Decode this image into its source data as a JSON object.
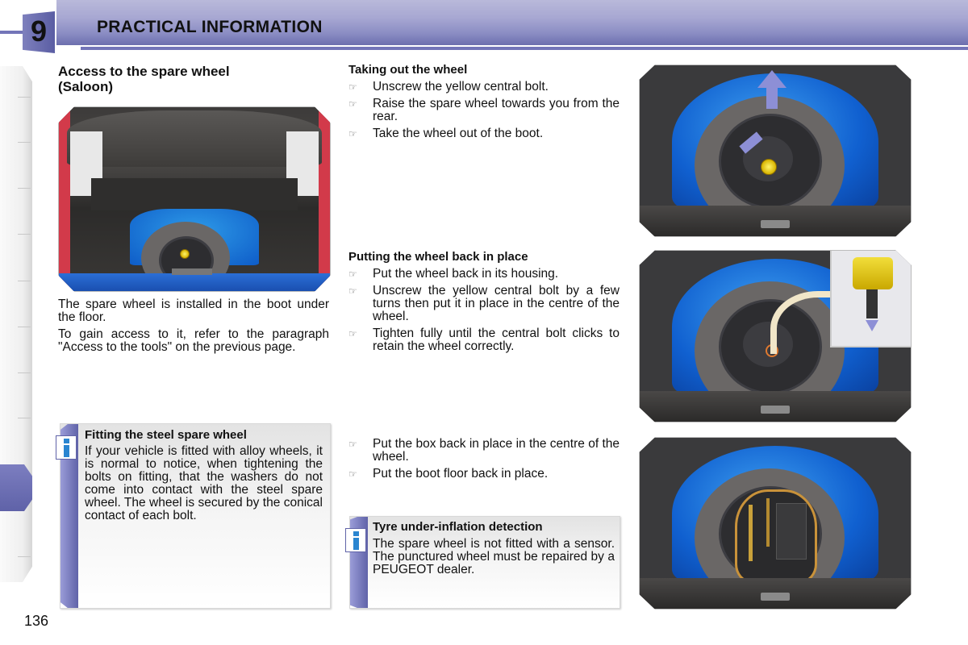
{
  "header": {
    "chapter_number": "9",
    "title": "PRACTICAL INFORMATION"
  },
  "left_column": {
    "heading_line1": "Access to the spare wheel",
    "heading_line2": "(Saloon)",
    "paragraphs": [
      "The spare wheel is installed in the boot under the floor.",
      "To gain access to it, refer to the paragraph \"Access to the tools\" on the previous page."
    ],
    "info_box": {
      "title": "Fitting the steel spare wheel",
      "text": "If your vehicle is fitted with alloy wheels, it is normal to notice, when tightening the bolts on fitting, that the washers do not come into contact with the steel spare wheel. The wheel is secured by the conical contact of each bolt."
    }
  },
  "middle_column": {
    "taking_out": {
      "title": "Taking out the wheel",
      "steps": [
        "Unscrew the yellow central bolt.",
        "Raise the spare wheel towards you from the rear.",
        "Take the wheel out of the boot."
      ]
    },
    "putting_back": {
      "title": "Putting the wheel back in place",
      "steps": [
        "Put the wheel back in its housing.",
        "Unscrew the yellow central bolt by a few turns then put it in place in the centre of the wheel.",
        "Tighten fully until the central bolt clicks to retain the wheel correctly."
      ]
    },
    "final_steps": [
      "Put the box back in place in the centre of the wheel.",
      "Put the boot floor back in place."
    ],
    "info_box": {
      "title": "Tyre under-inflation detection",
      "text": "The spare wheel is not fitted with a sensor. The punctured wheel must be repaired by a PEUGEOT dealer."
    }
  },
  "icons": {
    "bullet": "☞",
    "info": "i"
  },
  "colors": {
    "accent": "#7375b8",
    "info_blue": "#2a85d0",
    "bolt_yellow": "#e6c200"
  },
  "footer": {
    "page_number": "136"
  }
}
